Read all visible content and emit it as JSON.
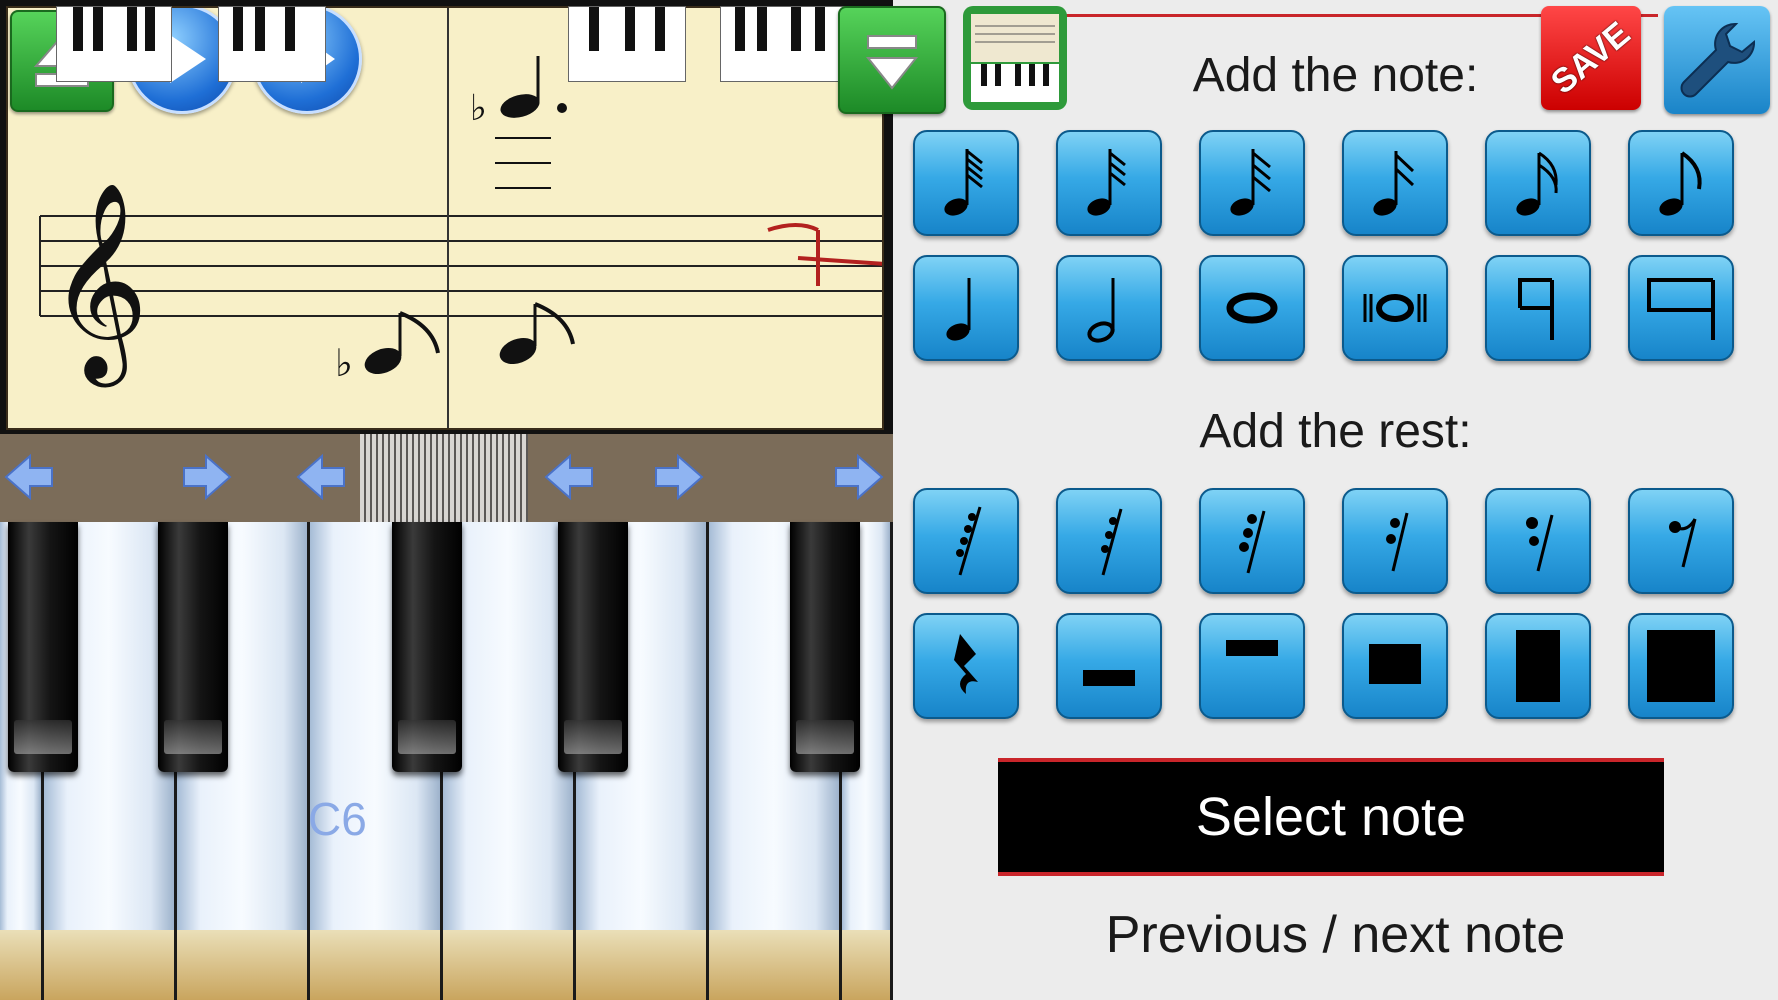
{
  "toolbar": {
    "icons": [
      "eject-up-icon",
      "play-icon",
      "play-step-icon",
      "collapse-down-icon",
      "piano-sheet-icon"
    ]
  },
  "keyboard": {
    "highlight_label": "C6",
    "nav_arrows": [
      "arrow-left-icon",
      "arrow-right-icon",
      "arrow-left-icon",
      "arrow-left-icon",
      "arrow-right-icon",
      "arrow-right-icon"
    ]
  },
  "panel": {
    "notes_heading": "Add the note:",
    "rests_heading": "Add the rest:",
    "save_label": "SAVE",
    "select_label": "Select note",
    "prev_next_label": "Previous / next note",
    "note_tiles": [
      "sixty-fourth-note-icon",
      "thirty-second-note-icon",
      "sixteenth-note-icon",
      "eighth-note-icon",
      "quarter-note-icon",
      "half-note-icon",
      "whole-note-icon",
      "double-whole-note-icon"
    ],
    "rest_tiles": [
      "sixty-fourth-rest-icon",
      "thirty-second-rest-icon",
      "sixteenth-rest-icon",
      "eighth-rest-icon",
      "quarter-rest-icon",
      "half-rest-icon",
      "whole-rest-icon",
      "double-whole-rest-icon"
    ]
  },
  "colors": {
    "accent_red": "#c9252a",
    "tile_blue": "#36a9e6",
    "sheet_paper": "#f8f0c8",
    "key_label": "#8aa9e6"
  }
}
